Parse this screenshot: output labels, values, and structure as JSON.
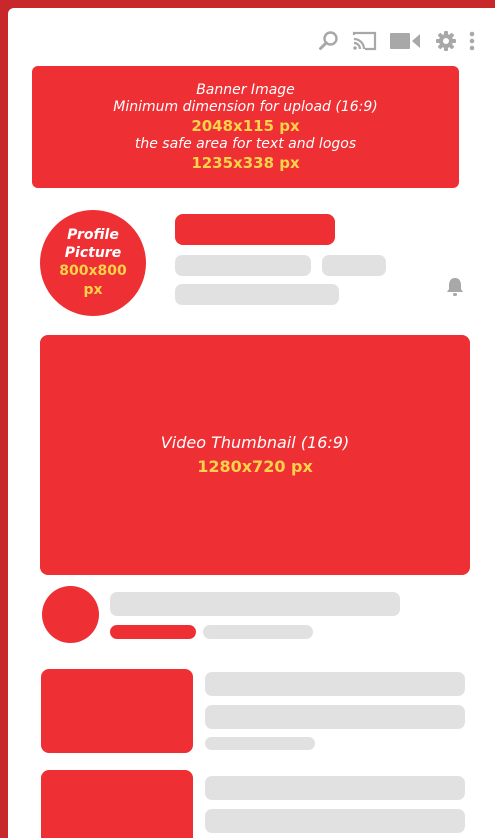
{
  "toolbar": {
    "icons": [
      "search-icon",
      "cast-icon",
      "camera-icon",
      "gear-icon",
      "more-vert-icon"
    ]
  },
  "banner": {
    "title": "Banner Image",
    "subtitle": "Minimum dimension for upload (16:9)",
    "min_size": "2048x115 px",
    "safe_area_label": "the safe area for text and logos",
    "safe_size": "1235x338 px"
  },
  "profile": {
    "label_line1": "Profile",
    "label_line2": "Picture",
    "size_line1": "800x800",
    "size_line2": "px"
  },
  "thumbnail": {
    "label": "Video Thumbnail (16:9)",
    "size": "1280x720 px"
  },
  "colors": {
    "accent": "#ee2f33",
    "frame": "#c8272b",
    "highlight": "#fcd24a",
    "placeholder": "#e1e1e1",
    "icon": "#a8a8a8"
  }
}
